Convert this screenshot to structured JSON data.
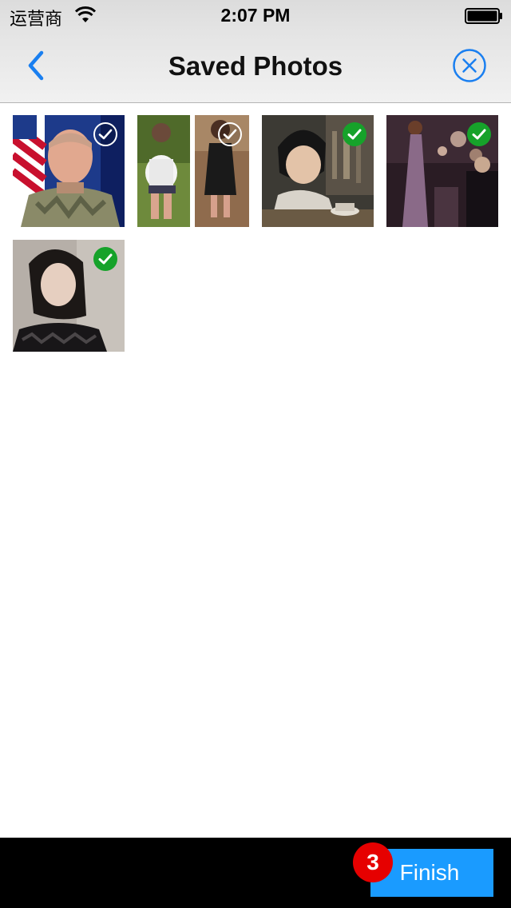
{
  "status_bar": {
    "carrier": "运营商",
    "time": "2:07 PM",
    "wifi_icon": "wifi-icon",
    "battery_icon": "battery-icon"
  },
  "nav": {
    "title": "Saved Photos",
    "back_icon": "chevron-left-icon",
    "close_icon": "close-circle-icon",
    "accent": "#1a7ff0"
  },
  "photos": [
    {
      "id": "photo-1",
      "selected": false
    },
    {
      "id": "photo-2",
      "selected": false
    },
    {
      "id": "photo-3",
      "selected": true
    },
    {
      "id": "photo-4",
      "selected": true
    },
    {
      "id": "photo-5",
      "selected": true
    }
  ],
  "bottom_bar": {
    "selected_count": "3",
    "finish_label": "Finish",
    "finish_color": "#1a9bff",
    "badge_color": "#e60000"
  }
}
